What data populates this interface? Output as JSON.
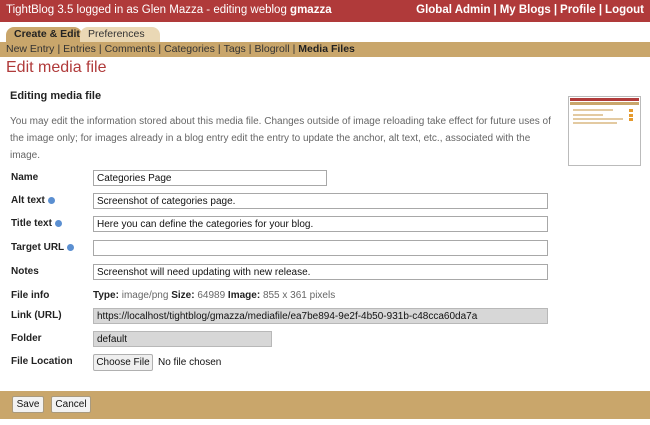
{
  "topbar": {
    "left_prefix": "TightBlog 3.5 logged in as Glen Mazza - editing weblog ",
    "weblog": "gmazza",
    "links": [
      "Global Admin",
      "My Blogs",
      "Profile",
      "Logout"
    ]
  },
  "tabs": {
    "active": "Create & Edit",
    "inactive": "Preferences"
  },
  "subnav": [
    "New Entry",
    "Entries",
    "Comments",
    "Categories",
    "Tags",
    "Blogroll",
    "Media Files"
  ],
  "page_title": "Edit media file",
  "section_title": "Editing media file",
  "description": "You may edit the information stored about this media file. Changes outside of image reloading take effect for future uses of the image only; for images already in a blog entry edit the entry to update the anchor, alt text, etc., associated with the image.",
  "form": {
    "name": {
      "label": "Name",
      "value": "Categories Page"
    },
    "alt_text": {
      "label": "Alt text",
      "value": "Screenshot of categories page."
    },
    "title_text": {
      "label": "Title text",
      "value": "Here you can define the categories for your blog."
    },
    "target_url": {
      "label": "Target URL",
      "value": ""
    },
    "notes": {
      "label": "Notes",
      "value": "Screenshot will need updating with new release."
    },
    "file_info": {
      "label": "File info",
      "type_label": "Type:",
      "type_value": "image/png",
      "size_label": "Size:",
      "size_value": "64989",
      "image_label": "Image:",
      "image_value": "855 x 361 pixels"
    },
    "link_url": {
      "label": "Link (URL)",
      "value": "https://localhost/tightblog/gmazza/mediafile/ea7be894-9e2f-4b50-931b-c48cca60da7a"
    },
    "folder": {
      "label": "Folder",
      "value": "default"
    },
    "file_location": {
      "label": "File Location",
      "button": "Choose File",
      "status": "No file chosen"
    }
  },
  "buttons": {
    "save": "Save",
    "cancel": "Cancel"
  },
  "colors": {
    "brand": "#b03a3a",
    "nav": "#c9a66b",
    "help": "#5b8fd1"
  }
}
